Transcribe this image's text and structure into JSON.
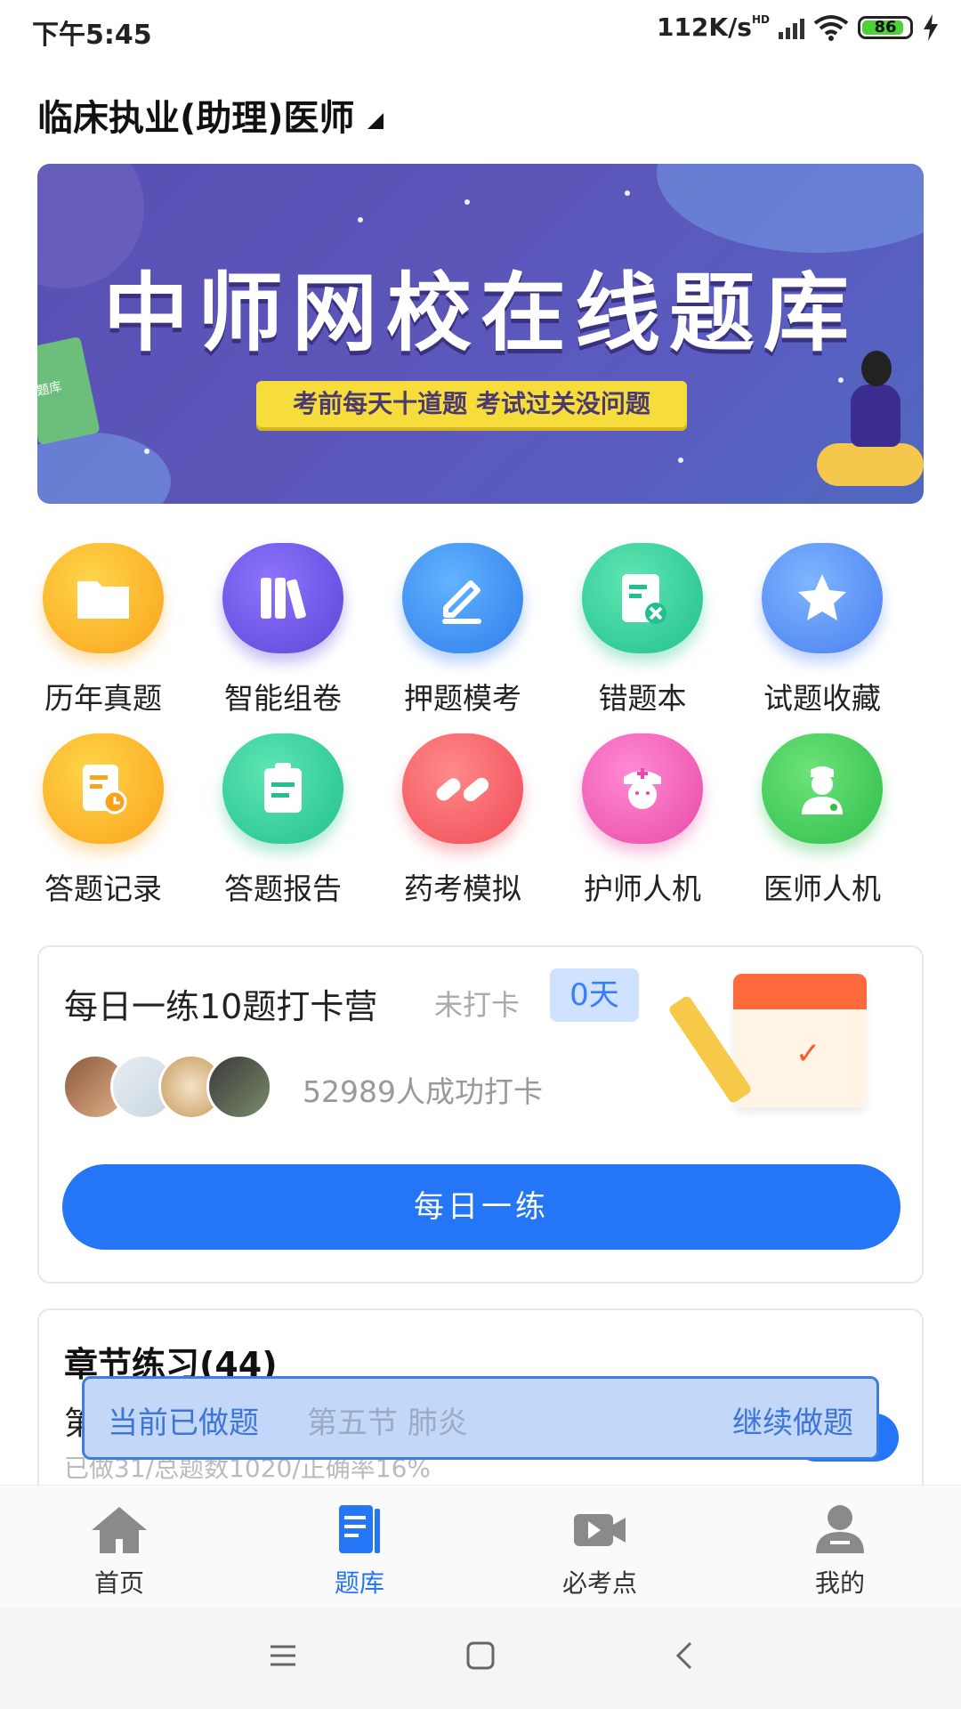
{
  "status_bar": {
    "time": "下午5:45",
    "network_speed": "112K/s",
    "battery_level": "86",
    "network_badge": "HD"
  },
  "header": {
    "exam_selector": "临床执业(助理)医师"
  },
  "banner": {
    "title": "中师网校在线题库",
    "subtitle": "考前每天十道题 考试过关没问题",
    "book_label": "题库"
  },
  "features": [
    {
      "label": "历年真题",
      "icon": "folder-icon"
    },
    {
      "label": "智能组卷",
      "icon": "books-icon"
    },
    {
      "label": "押题模考",
      "icon": "pen-icon"
    },
    {
      "label": "错题本",
      "icon": "wrong-note-icon"
    },
    {
      "label": "试题收藏",
      "icon": "star-icon"
    },
    {
      "label": "答题记录",
      "icon": "record-clock-icon"
    },
    {
      "label": "答题报告",
      "icon": "clipboard-icon"
    },
    {
      "label": "药考模拟",
      "icon": "pill-icon"
    },
    {
      "label": "护师人机",
      "icon": "nurse-icon"
    },
    {
      "label": "医师人机",
      "icon": "doctor-icon"
    }
  ],
  "daily_practice": {
    "title": "每日一练10题打卡营",
    "status": "未打卡",
    "days": "0天",
    "participants": "52989人成功打卡",
    "button": "每日一练"
  },
  "chapter_practice": {
    "title": "章节练习(44)",
    "row_prefix": "第",
    "stats": "已做31/总题数1020/正确率16%"
  },
  "toast": {
    "label": "当前已做题",
    "section": "第五节 肺炎",
    "action": "继续做题"
  },
  "bottom_nav": [
    {
      "label": "首页",
      "icon": "home-icon",
      "active": false
    },
    {
      "label": "题库",
      "icon": "question-bank-icon",
      "active": true
    },
    {
      "label": "必考点",
      "icon": "video-icon",
      "active": false
    },
    {
      "label": "我的",
      "icon": "profile-icon",
      "active": false
    }
  ],
  "colors": {
    "accent": "#2476f7",
    "banner": "#5a4fb4"
  }
}
